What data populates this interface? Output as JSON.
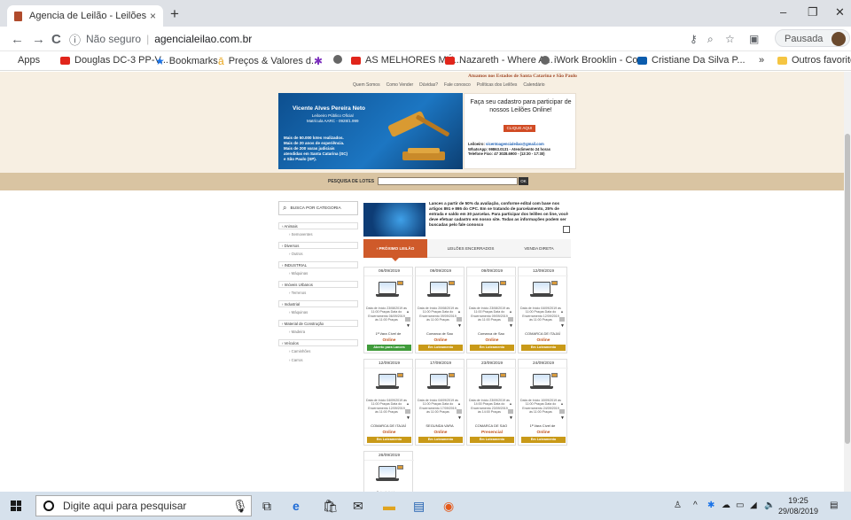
{
  "browser": {
    "tab_title": "Agencia de Leilão - Leilões Judic",
    "tab_close": "×",
    "new_tab": "+",
    "nav_back": "←",
    "nav_forward": "→",
    "nav_reload": "C",
    "security_label": "Não seguro",
    "url": "agencialeilao.com.br",
    "profile_label": "Pausada",
    "window_minimize": "–",
    "window_maximize": "❐",
    "window_close": "✕"
  },
  "bookmarks": [
    {
      "label": "Apps",
      "icon": "apps-icon"
    },
    {
      "label": "Douglas DC-3 PP-V...",
      "icon": "youtube-icon"
    },
    {
      "label": "Bookmarks",
      "icon": "star-icon"
    },
    {
      "label": "Preços & Valores d...",
      "icon": "chart-icon"
    },
    {
      "label": "",
      "icon": "figure-icon"
    },
    {
      "label": "",
      "icon": "globe-icon"
    },
    {
      "label": "AS MELHORES MÚ...",
      "icon": "youtube-icon"
    },
    {
      "label": "Nazareth - Where A...",
      "icon": "youtube-icon"
    },
    {
      "label": "iWork Brooklin - Co...",
      "icon": "globe-icon"
    },
    {
      "label": "Cristiane Da Silva P...",
      "icon": "outlook-icon"
    },
    {
      "label": "»",
      "icon": "more-icon"
    },
    {
      "label": "Outros favoritos",
      "icon": "folder-icon"
    }
  ],
  "site": {
    "tagline": "Atuamos nos Estados de Santa Catarina e São Paulo",
    "menu": [
      "Quem Somos",
      "Como Vender",
      "Dúvidas?",
      "Fale conosco",
      "Políticas dos Leilões",
      "Calendário"
    ],
    "hero_name": "Vicente Alves Pereira  Neto",
    "hero_sub": [
      "Leiloeiro Público Oficial",
      "Matrícula AARC - 0928/1.999"
    ],
    "hero_stats": [
      "Mais de 50.000 lotes realizados.",
      "Mais de 20 anos de experiência.",
      "Mais de 200 varas judiciais",
      "atendidas em Santa Catarina (SC)",
      "e São Paulo (SP)."
    ],
    "promo_title": "Faça seu cadastro para participar de nossos Leilões Online!",
    "promo_button": "CLIQUE AQUI",
    "promo_info": [
      {
        "k": "Leiloeiro:",
        "v": " vicentoagencialeilao@gmail.com"
      },
      {
        "k": "WhatsApp:",
        "v": " 99863.0131 - Atendimento 24 horas"
      },
      {
        "k": "Telefone Fixo:",
        "v": " 47 3028.6900 - (13:30 - 17:30)"
      }
    ],
    "search_label": "PESQUISA DE LOTES",
    "search_button": "OK",
    "category_header": "BUSCA POR CATEGORIA",
    "categories": [
      {
        "name": "Animais",
        "sub": "Semoventes"
      },
      {
        "name": "Diversos",
        "sub": "Outros"
      },
      {
        "name": "INDUSTRIAL",
        "sub": "Máquinas"
      },
      {
        "name": "Imóveis Urbanos",
        "sub": "Terrenos"
      },
      {
        "name": "Industrial",
        "sub": "Máquinas"
      },
      {
        "name": "Material de Construção",
        "sub": "Madeira"
      },
      {
        "name": "Veículos",
        "sub": "Caminhões"
      },
      {
        "name": "",
        "sub": "Carros"
      }
    ],
    "notice": "Lances a partir de 50% da avaliação, conforme edital com base nos artigos 891 e 895 do CPC. Em se tratando de parcelamento, 25% de entrada e saldo em 30 parcelas. Para participar dos leilões on line, você deve efetuar cadastro em nosso site. Todas as informações podem ser buscadas pelo fale conosco",
    "tabs": [
      "PRÓXIMO LEILÃO",
      "LEILÕES ENCERRADOS",
      "VENDA DIRETA"
    ],
    "cards": [
      {
        "date": "06/09/2019",
        "info": "Data de Início 23/08/2019 às 11:00 Praças Data do Encerramento 06/09/2019 às 11:00 Praças",
        "loc": "1ª Vara Cível de",
        "status_text": "Online",
        "status": "Aberto para Lances",
        "color": "green"
      },
      {
        "date": "09/09/2019",
        "info": "Data de Início 20/08/2019 às 11:00 Praças Data do Encerramento 09/09/2019 às 11:00 Praças",
        "loc": "Comarca de Sao",
        "status_text": "Online",
        "status": "Em Loteamento",
        "color": "gold"
      },
      {
        "date": "09/09/2019",
        "info": "Data de Início 23/08/2019 às 11:00 Praças Data do Encerramento 09/09/2019 às 11:00 Praças",
        "loc": "Comarca de Sao",
        "status_text": "Online",
        "status": "Em Loteamento",
        "color": "gold"
      },
      {
        "date": "12/09/2019",
        "info": "Data de Início 04/09/2019 às 11:00 Praças Data do Encerramento 12/09/2019 às 11:00 Praças",
        "loc": "COMARCA DE ITAJAÍ",
        "status_text": "Online",
        "status": "Em Loteamento",
        "color": "gold"
      },
      {
        "date": "12/09/2019",
        "info": "Data de Início 04/09/2019 às 11:00 Praças Data do Encerramento 12/09/2019 às 11:00 Praças",
        "loc": "COMARCA DE ITAJAÍ",
        "status_text": "Online",
        "status": "Em Loteamento",
        "color": "gold"
      },
      {
        "date": "17/09/2019",
        "info": "Data de Início 04/09/2019 às 11:00 Praças Data do Encerramento 17/09/2019 às 11:00 Praças",
        "loc": "SEGUNDA VARA",
        "status_text": "Online",
        "status": "Em Loteamento",
        "color": "gold"
      },
      {
        "date": "23/09/2019",
        "info": "Data de Início 23/09/2019 às 14:00 Praças Data do Encerramento 23/09/2019 às 14:00 Praças",
        "loc": "COMARCA DE SAO",
        "status_text": "Presencial",
        "status": "Em Loteamento",
        "color": "gold"
      },
      {
        "date": "24/09/2019",
        "info": "Data de Início 10/09/2019 às 11:00 Praças Data do Encerramento 24/09/2019 às 11:00 Praças",
        "loc": "1ª Vara Cível de",
        "status_text": "Online",
        "status": "Em Loteamento",
        "color": "gold"
      },
      {
        "date": "26/09/2019",
        "info": "Data de Início",
        "loc": "",
        "status_text": "",
        "status": "",
        "color": "gold"
      }
    ]
  },
  "taskbar": {
    "search_placeholder": "Digite aqui para pesquisar",
    "time": "19:25",
    "date": "29/08/2019"
  }
}
